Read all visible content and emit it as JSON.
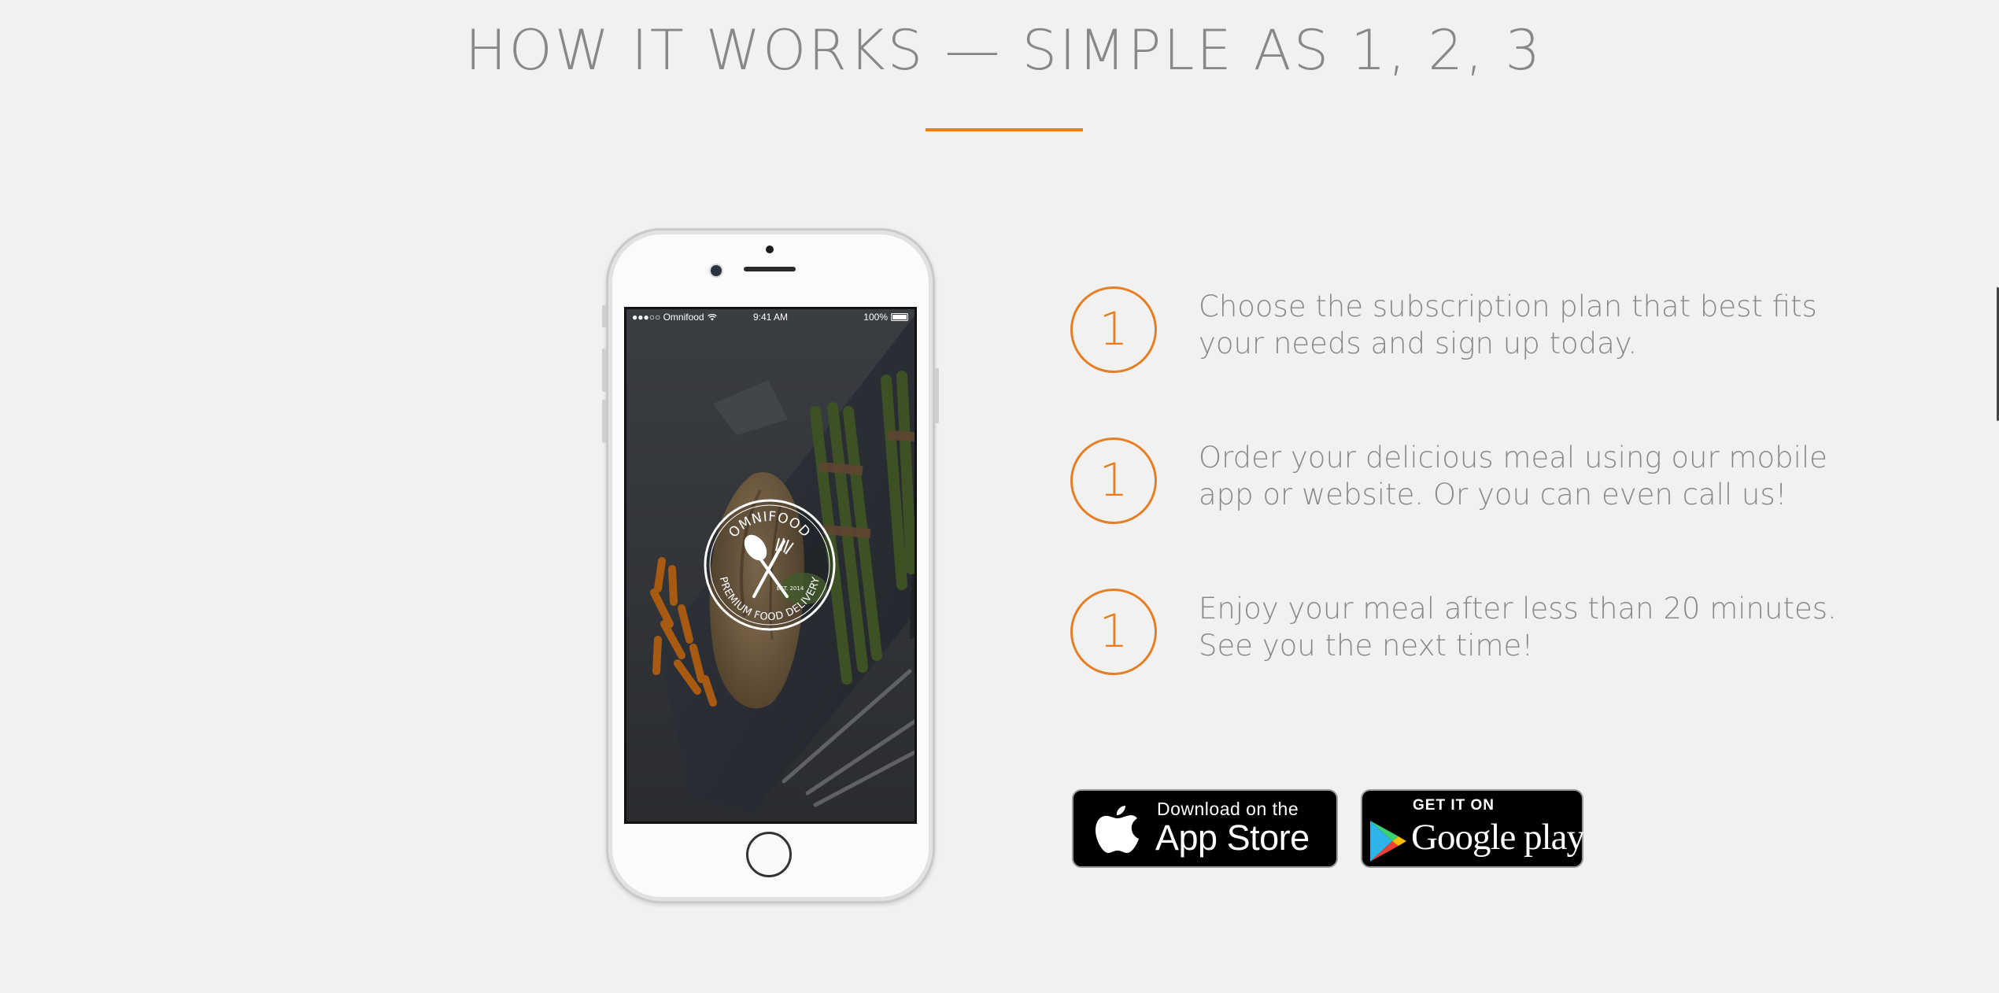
{
  "section": {
    "title": "HOW IT WORKS — SIMPLE AS 1, 2, 3",
    "accent_color": "#e67e22"
  },
  "phone": {
    "status_bar": {
      "carrier": "●●●○○ Omnifood",
      "time": "9:41 AM",
      "battery": "100%"
    },
    "logo": {
      "brand": "OMNIFOOD",
      "tagline": "PREMIUM FOOD DELIVERY",
      "est": "EST. 2014"
    }
  },
  "steps": [
    {
      "number": "1",
      "text": "Choose the subscription plan that best fits your needs and sign up today."
    },
    {
      "number": "1",
      "text": "Order your delicious meal using our mobile app or website. Or you can even call us!"
    },
    {
      "number": "1",
      "text": "Enjoy your meal after less than 20 minutes. See you the next time!"
    }
  ],
  "badges": {
    "apple": {
      "small": "Download on the",
      "big": "App Store",
      "icon": "apple-icon"
    },
    "google": {
      "small": "GET IT ON",
      "big": "Google play",
      "icon": "google-play-icon"
    }
  }
}
